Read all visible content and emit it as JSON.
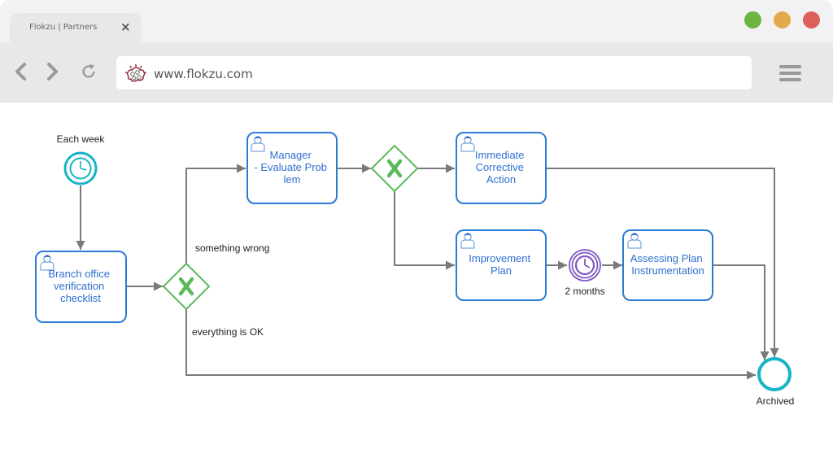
{
  "browser": {
    "tab_title": "Flokzu | Partners",
    "tab_close": "×",
    "url": "www.flokzu.com",
    "window_controls": [
      {
        "name": "maximize",
        "color": "#6db543"
      },
      {
        "name": "minimize",
        "color": "#e3a94b"
      },
      {
        "name": "close",
        "color": "#dd5f5a"
      }
    ],
    "icons": [
      "back-icon",
      "forward-icon",
      "reload-icon",
      "flokzu-logo-icon",
      "hamburger-menu-icon"
    ]
  },
  "diagram": {
    "start_event": {
      "label": "Each week",
      "type": "timer-start"
    },
    "tasks": [
      {
        "id": "branch",
        "lines": [
          "Branch office",
          "verification",
          "checklist"
        ]
      },
      {
        "id": "manager",
        "lines": [
          "Manager",
          "- Evaluate Prob",
          "lem"
        ]
      },
      {
        "id": "immediate",
        "lines": [
          "Immediate",
          "Corrective",
          "Action"
        ]
      },
      {
        "id": "improvement",
        "lines": [
          "Improvement",
          "Plan"
        ]
      },
      {
        "id": "assessing",
        "lines": [
          "Assessing Plan",
          "Instrumentation"
        ]
      }
    ],
    "gateways": [
      {
        "id": "gw1",
        "type": "exclusive"
      },
      {
        "id": "gw2",
        "type": "exclusive"
      }
    ],
    "timer_event": {
      "label": "2 months"
    },
    "end_event": {
      "label": "Archived"
    },
    "flow_labels": {
      "wrong": "something wrong",
      "ok": "everything is OK"
    },
    "colors": {
      "task_border": "#2a7bd6",
      "task_text": "#2f6fd0",
      "gateway": "#5cb85c",
      "start_event": "#17b3c7",
      "timer_event": "#7e57c2",
      "end_event": "#17b3c7",
      "flow": "#7a7a7a"
    }
  }
}
